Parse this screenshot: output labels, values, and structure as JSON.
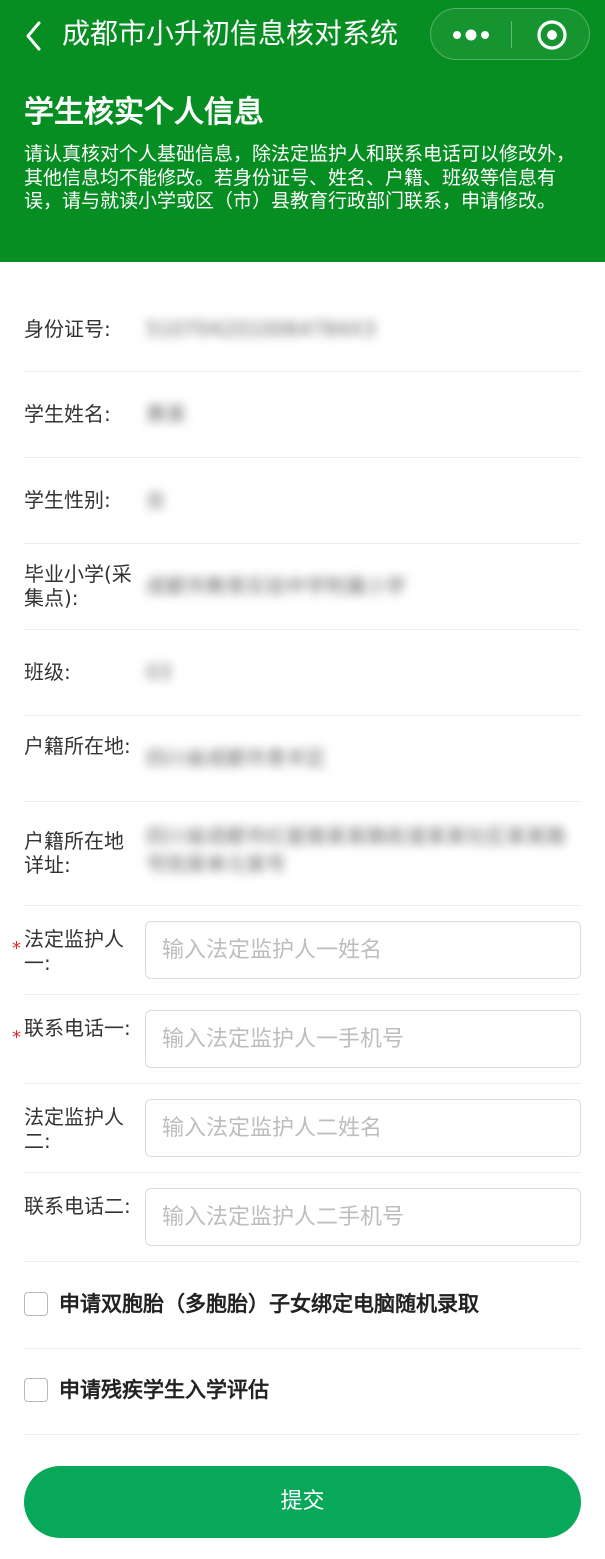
{
  "nav": {
    "title": "成都市小升初信息核对系统",
    "back_icon": "chevron-left-icon",
    "more_icon": "more-dots-icon",
    "close_icon": "target-close-icon"
  },
  "intro": {
    "heading": "学生核实个人信息",
    "description": "请认真核对个人基础信息，除法定监护人和联系电话可以修改外，其他信息均不能修改。若身份证号、姓名、户籍、班级等信息有误，请与就读小学或区（市）县教育行政部门联系，申请修改。"
  },
  "fields": {
    "id_number": {
      "label": "身份证号:",
      "value": "5107042010064784X3"
    },
    "student_name": {
      "label": "学生姓名:",
      "value": "黄某"
    },
    "student_gender": {
      "label": "学生性别:",
      "value": "女"
    },
    "primary_school": {
      "label": "毕业小学(采集点):",
      "value": "成都市教育实验中学附属小学"
    },
    "class": {
      "label": "班级:",
      "value": "03"
    },
    "hukou_location": {
      "label": "户籍所在地:",
      "value": "四川省成都市青羊区"
    },
    "hukou_address": {
      "label": "户籍所在地详址:",
      "value": "四川省成都市红星路某某路街道某某社区某某路号院某单元某号"
    }
  },
  "guardians": {
    "guardian1_name": {
      "label": "法定监护人一:",
      "placeholder": "输入法定监护人一姓名",
      "value": "",
      "required": true
    },
    "guardian1_phone": {
      "label": "联系电话一:",
      "placeholder": "输入法定监护人一手机号",
      "value": "",
      "required": true
    },
    "guardian2_name": {
      "label": "法定监护人二:",
      "placeholder": "输入法定监护人二姓名",
      "value": "",
      "required": false
    },
    "guardian2_phone": {
      "label": "联系电话二:",
      "placeholder": "输入法定监护人二手机号",
      "value": "",
      "required": false
    },
    "required_mark": "*"
  },
  "options": {
    "twins": {
      "label": "申请双胞胎（多胞胎）子女绑定电脑随机录取",
      "checked": false
    },
    "disability": {
      "label": "申请残疾学生入学评估",
      "checked": false
    }
  },
  "submit": {
    "label": "提交"
  },
  "colors": {
    "header_bg": "#078e23",
    "submit_bg": "#08a85a",
    "required_mark": "#e02a2a"
  }
}
